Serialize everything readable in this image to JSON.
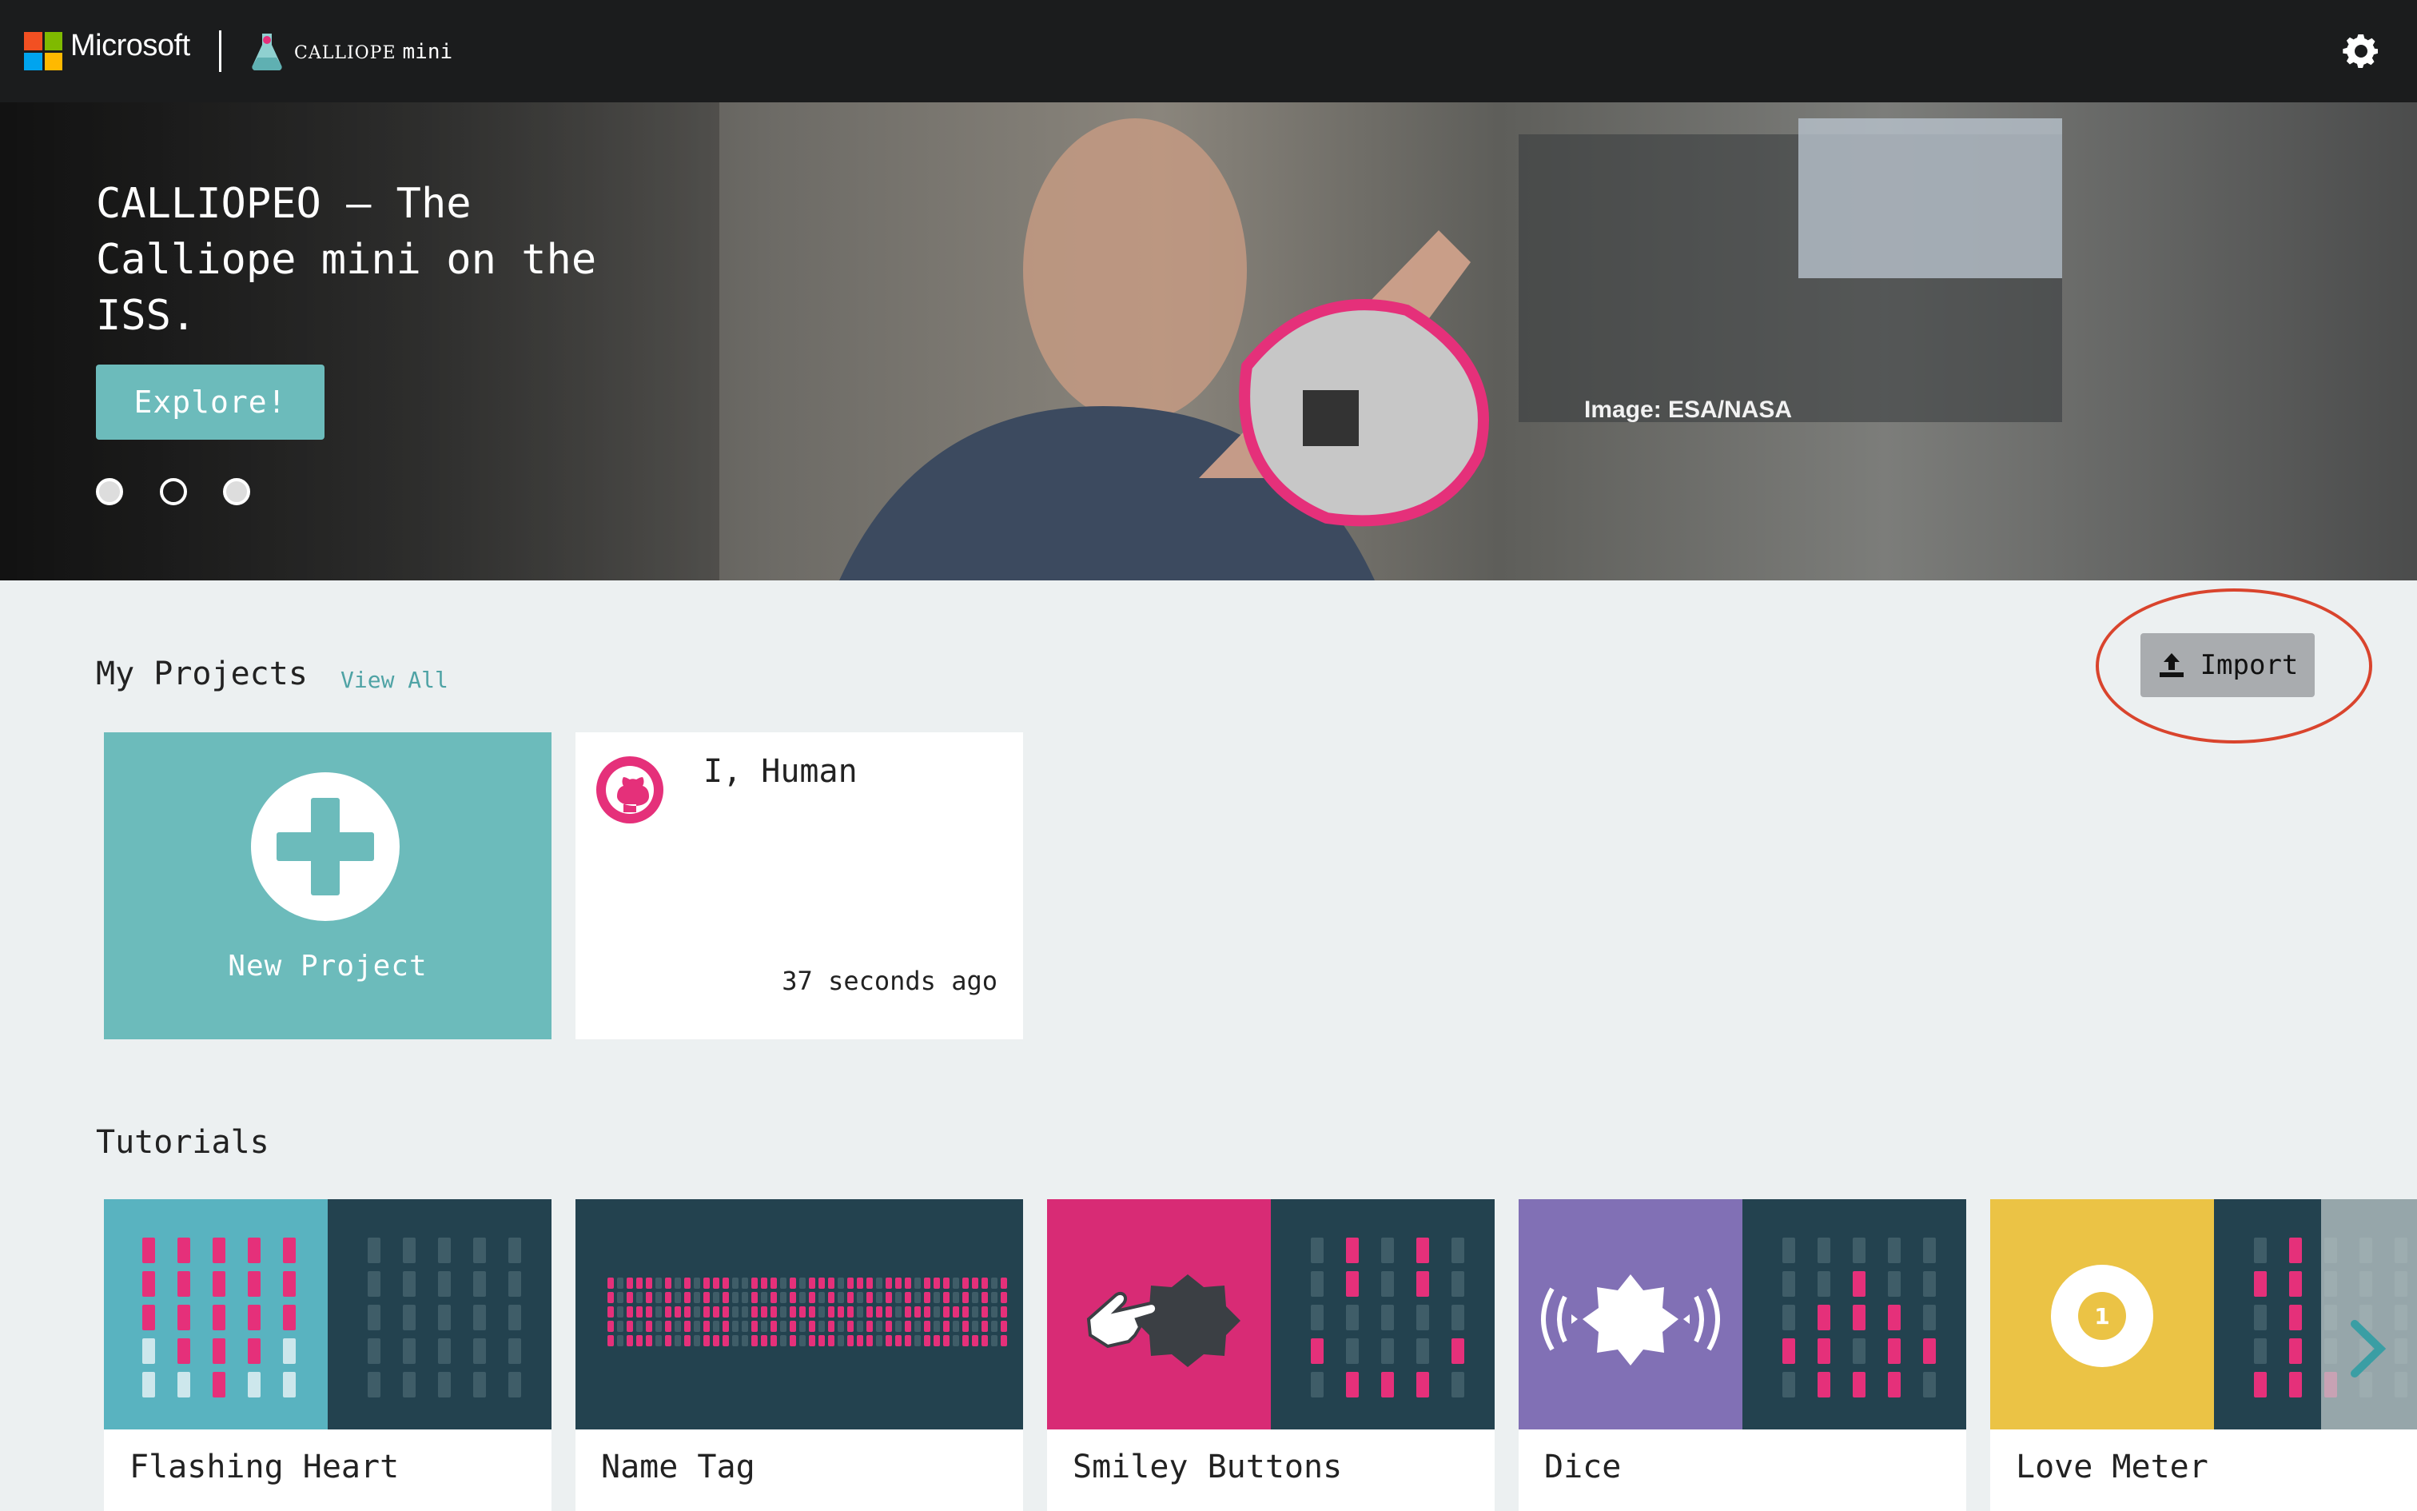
{
  "topbar": {
    "brand": "Microsoft",
    "product_small": "CALLIOPE",
    "product_main": "mini",
    "settings_icon": "gear-icon"
  },
  "hero": {
    "title": "CALLIOPEO – The Calliope mini on the ISS.",
    "cta_label": "Explore!",
    "image_credit": "Image: ESA/NASA",
    "carousel_dots": 3,
    "active_dot": 2
  },
  "projects": {
    "title": "My Projects",
    "view_all": "View All",
    "import_label": "Import",
    "new_project_label": "New Project",
    "items": [
      {
        "name": "I, Human",
        "time": "37 seconds ago",
        "icon": "github-icon"
      }
    ]
  },
  "tutorials": {
    "title": "Tutorials",
    "items": [
      {
        "label": "Flashing Heart"
      },
      {
        "label": "Name Tag"
      },
      {
        "label": "Smiley Buttons"
      },
      {
        "label": "Dice"
      },
      {
        "label": "Love Meter"
      }
    ]
  },
  "colors": {
    "teal": "#6cbbbb",
    "dark_teal": "#23424f",
    "pink": "#e5307a",
    "purple": "#8170b5",
    "yellow": "#ebc345",
    "annotation_red": "#d9442d"
  }
}
